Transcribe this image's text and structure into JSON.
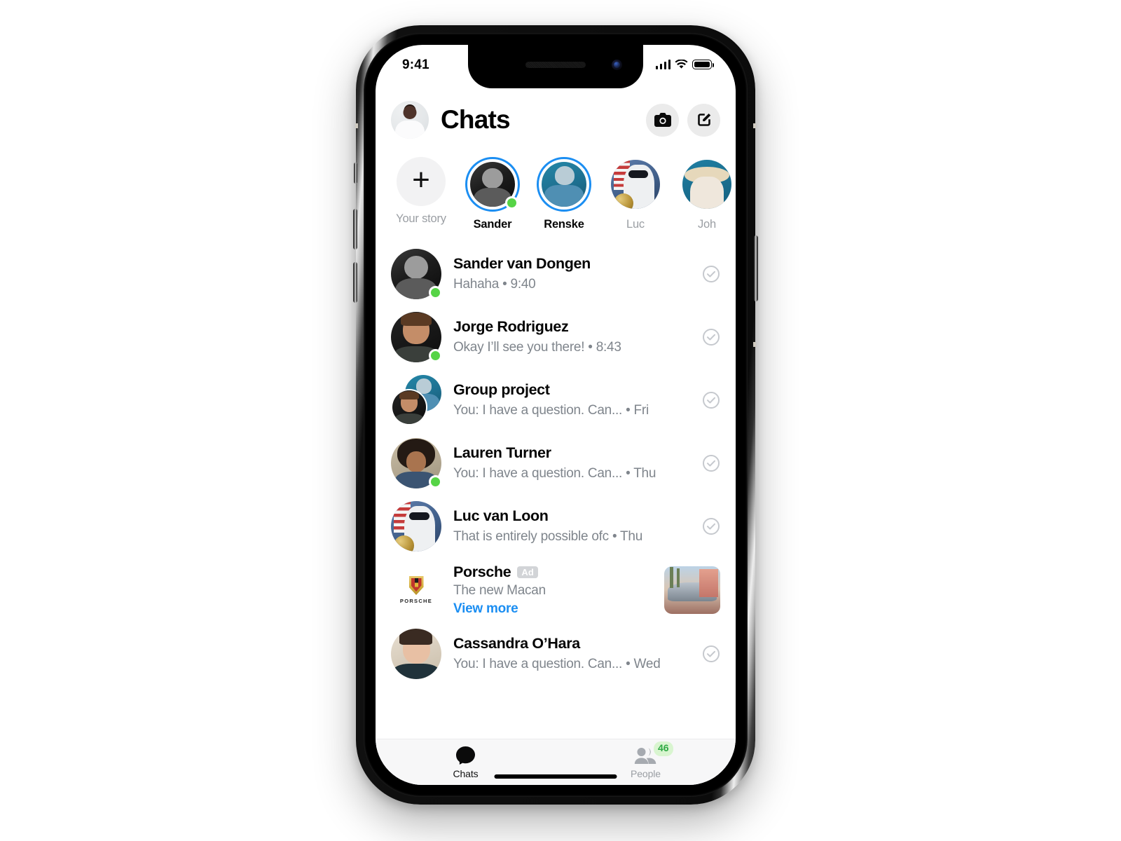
{
  "status_bar": {
    "time": "9:41",
    "signal": "signal-bars-icon",
    "wifi": "wifi-icon",
    "battery": "battery-icon"
  },
  "header": {
    "title": "Chats",
    "avatar_name": "my-profile-avatar",
    "camera_label": "camera-icon",
    "compose_label": "compose-icon"
  },
  "stories": {
    "add_label": "Your story",
    "items": [
      {
        "label": "Sander",
        "active": true,
        "online": true
      },
      {
        "label": "Renske",
        "active": true,
        "online": false
      },
      {
        "label": "Luc",
        "active": false,
        "online": false
      },
      {
        "label": "Joh",
        "active": false,
        "online": false
      }
    ]
  },
  "chats": [
    {
      "name": "Sander van Dongen",
      "snippet": "Hahaha • 9:40",
      "online": true,
      "read": true,
      "type": "single",
      "art": "ph-sander"
    },
    {
      "name": "Jorge Rodriguez",
      "snippet": "Okay I’ll see you there! • 8:43",
      "online": true,
      "read": true,
      "type": "single",
      "art": "ph-jorge"
    },
    {
      "name": "Group project",
      "snippet": "You: I have a question. Can... • Fri",
      "online": false,
      "read": true,
      "type": "group",
      "art": "ph-renske",
      "art2": "ph-jorge"
    },
    {
      "name": "Lauren Turner",
      "snippet": "You: I have a question. Can... • Thu",
      "online": true,
      "read": true,
      "type": "single",
      "art": "ph-lauren"
    },
    {
      "name": "Luc van Loon",
      "snippet": "That is entirely possible ofc • Thu",
      "online": false,
      "read": true,
      "type": "single",
      "art": "ph-luc"
    }
  ],
  "ad": {
    "brand": "Porsche",
    "badge": "Ad",
    "wordmark": "PORSCHE",
    "subtitle": "The new Macan",
    "cta": "View more",
    "cta_color": "#1b8ef2"
  },
  "chats_after_ad": [
    {
      "name": "Cassandra O’Hara",
      "snippet": "You: I have a question. Can... • Wed",
      "online": false,
      "read": true,
      "type": "single",
      "art": "ph-cass"
    }
  ],
  "tabs": [
    {
      "label": "Chats",
      "active": true,
      "badge": ""
    },
    {
      "label": "People",
      "active": false,
      "badge": "46"
    }
  ],
  "colors": {
    "accent_blue": "#1b8ef2",
    "online_green": "#56d446",
    "badge_green_text": "#2fa944",
    "badge_green_bg": "#d9f5d0",
    "secondary_text": "#7f858c",
    "primary_text": "#050505"
  }
}
